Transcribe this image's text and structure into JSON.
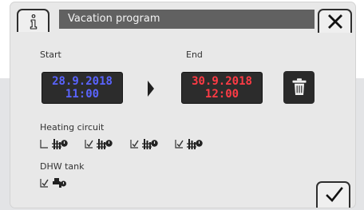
{
  "header": {
    "title": "Vacation program",
    "info_icon": "info-icon",
    "close_icon": "close-icon"
  },
  "period": {
    "start_label": "Start",
    "end_label": "End",
    "start_date": "28.9.2018",
    "start_time": "11:00",
    "end_date": "30.9.2018",
    "end_time": "12:00",
    "arrow_icon": "chevron-right-icon",
    "delete_icon": "trash-icon"
  },
  "heating": {
    "label": "Heating circuit",
    "items": [
      {
        "checked": false,
        "icon": "heating-circuit-icon"
      },
      {
        "checked": true,
        "icon": "heating-circuit-icon"
      },
      {
        "checked": true,
        "icon": "heating-circuit-icon"
      },
      {
        "checked": true,
        "icon": "heating-circuit-icon"
      }
    ]
  },
  "dhw": {
    "label": "DHW tank",
    "items": [
      {
        "checked": true,
        "icon": "dhw-tap-icon"
      }
    ]
  },
  "footer": {
    "confirm_icon": "checkmark-icon"
  },
  "colors": {
    "start_text": "#5a64ff",
    "end_text": "#ff3b45",
    "title_bar": "#616161",
    "screen": "#e8e8e8"
  }
}
